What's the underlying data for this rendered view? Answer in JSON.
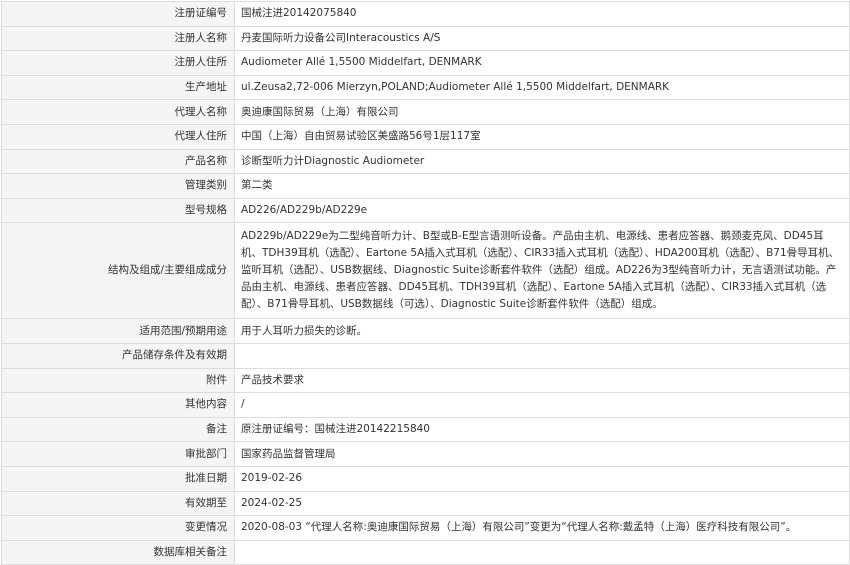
{
  "rows": [
    {
      "key": "registration-number",
      "label": "注册证编号",
      "value": "国械注进20142075840"
    },
    {
      "key": "registrant-name",
      "label": "注册人名称",
      "value": "丹麦国际听力设备公司Interacoustics A/S"
    },
    {
      "key": "registrant-address",
      "label": "注册人住所",
      "value": "Audiometer Allé 1,5500 Middelfart, DENMARK"
    },
    {
      "key": "production-address",
      "label": "生产地址",
      "value": "ul.Zeusa2,72-006 Mierzyn,POLAND;Audiometer Allé 1,5500 Middelfart, DENMARK"
    },
    {
      "key": "agent-name",
      "label": "代理人名称",
      "value": "奥迪康国际贸易（上海）有限公司"
    },
    {
      "key": "agent-address",
      "label": "代理人住所",
      "value": "中国（上海）自由贸易试验区美盛路56号1层117室"
    },
    {
      "key": "product-name",
      "label": "产品名称",
      "value": "诊断型听力计Diagnostic Audiometer"
    },
    {
      "key": "management-category",
      "label": "管理类别",
      "value": "第二类"
    },
    {
      "key": "model-spec",
      "label": "型号规格",
      "value": "AD226/AD229b/AD229e"
    },
    {
      "key": "structure-composition",
      "label": "结构及组成/主要组成成分",
      "value": "AD229b/AD229e为二型纯音听力计、B型或B-E型言语测听设备。产品由主机、电源线、患者应答器、鹅颈麦克风、DD45耳机、TDH39耳机（选配）、Eartone 5A插入式耳机（选配）、CIR33插入式耳机（选配）、HDA200耳机（选配）、B71骨导耳机、监听耳机（选配）、USB数据线、Diagnostic Suite诊断套件软件（选配）组成。AD226为3型纯音听力计，无言语测试功能。产品由主机、电源线、患者应答器、DD45耳机、TDH39耳机（选配）、Eartone 5A插入式耳机（选配）、CIR33插入式耳机（选配）、B71骨导耳机、USB数据线（可选）、Diagnostic Suite诊断套件软件（选配）组成。"
    },
    {
      "key": "intended-use",
      "label": "适用范围/预期用途",
      "value": "用于人耳听力损失的诊断。"
    },
    {
      "key": "storage-conditions",
      "label": "产品储存条件及有效期",
      "value": ""
    },
    {
      "key": "attachments",
      "label": "附件",
      "value": "产品技术要求"
    },
    {
      "key": "other-content",
      "label": "其他内容",
      "value": "/"
    },
    {
      "key": "remarks",
      "label": "备注",
      "value": "原注册证编号：国械注进20142215840"
    },
    {
      "key": "approval-department",
      "label": "审批部门",
      "value": "国家药品监督管理局"
    },
    {
      "key": "approval-date",
      "label": "批准日期",
      "value": "2019-02-26"
    },
    {
      "key": "valid-until",
      "label": "有效期至",
      "value": "2024-02-25"
    },
    {
      "key": "change-history",
      "label": "变更情况",
      "value": "2020-08-03 “代理人名称:奥迪康国际贸易（上海）有限公司”变更为“代理人名称:戴孟特（上海）医疗科技有限公司”。"
    },
    {
      "key": "database-notes",
      "label": "数据库相关备注",
      "value": ""
    }
  ]
}
